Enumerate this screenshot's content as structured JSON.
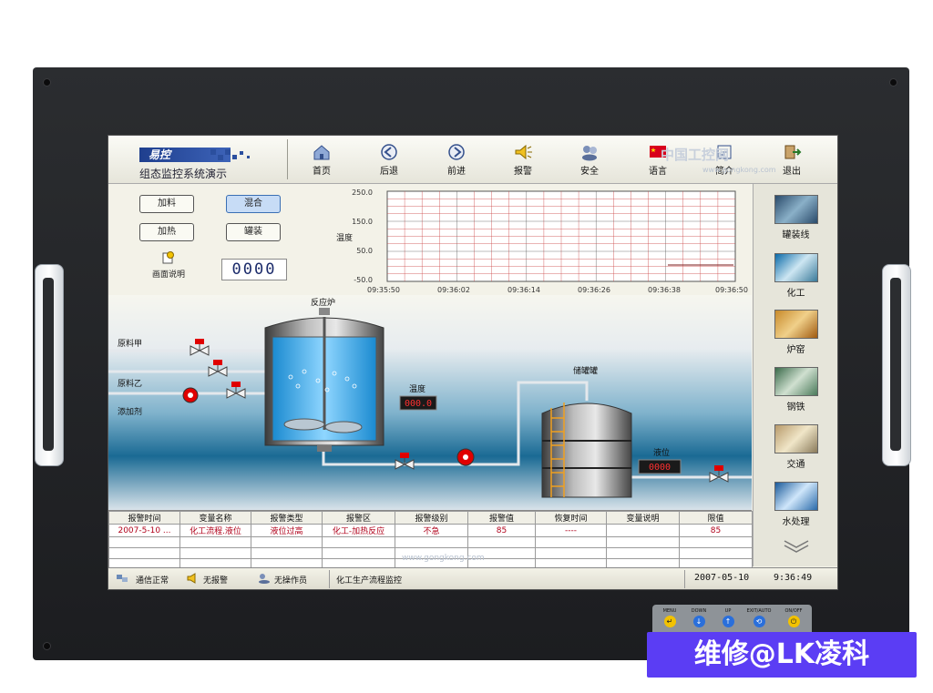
{
  "app": {
    "logo_text": "易控",
    "title": "组态监控系统演示"
  },
  "nav": [
    {
      "label": "首页",
      "icon": "home-icon"
    },
    {
      "label": "后退",
      "icon": "back-arrow-icon"
    },
    {
      "label": "前进",
      "icon": "forward-arrow-icon"
    },
    {
      "label": "报警",
      "icon": "alarm-horn-icon"
    },
    {
      "label": "安全",
      "icon": "users-icon"
    },
    {
      "label": "语言",
      "icon": "china-flag-icon"
    },
    {
      "label": "简介",
      "icon": "intro-icon"
    },
    {
      "label": "退出",
      "icon": "exit-icon"
    }
  ],
  "controls": {
    "btn_feed": "加料",
    "btn_mix": "混合",
    "btn_heat": "加热",
    "btn_fill": "罐装",
    "screen_desc": "画面说明",
    "counter": "0000"
  },
  "trend": {
    "ylabel": "温度",
    "yticks": [
      "250.0",
      "150.0",
      "50.0",
      "-50.0"
    ],
    "xticks": [
      "09:35:50",
      "09:36:02",
      "09:36:14",
      "09:36:26",
      "09:36:38",
      "09:36:50"
    ]
  },
  "process": {
    "reactor_label": "反应炉",
    "tank_label": "储罐罐",
    "line_a": "原料甲",
    "line_b": "原料乙",
    "line_c": "添加剂",
    "temp_label": "温度",
    "temp_value": "000.0",
    "level_label": "液位",
    "level_value": "0000"
  },
  "rightbar": [
    {
      "label": "罐装线",
      "icon": "filling-line-icon"
    },
    {
      "label": "化工",
      "icon": "chemical-icon"
    },
    {
      "label": "炉窑",
      "icon": "kiln-icon"
    },
    {
      "label": "钢铁",
      "icon": "steel-icon"
    },
    {
      "label": "交通",
      "icon": "traffic-icon"
    },
    {
      "label": "水处理",
      "icon": "water-treatment-icon"
    }
  ],
  "alarm": {
    "headers": [
      "报警时间",
      "变量名称",
      "报警类型",
      "报警区",
      "报警级别",
      "报警值",
      "恢复时间",
      "变量说明",
      "限值"
    ],
    "rows": [
      [
        "2007-5-10 ...",
        "化工流程.液位",
        "液位过高",
        "化工-加热反应",
        "不急",
        "85",
        "----",
        "",
        "85"
      ]
    ]
  },
  "status": {
    "comm": "通信正常",
    "alarm": "无报警",
    "operator": "无操作员",
    "desc": "化工生产流程监控",
    "date": "2007-05-10",
    "time": "9:36:49"
  },
  "watermarks": {
    "top": "中国工控网",
    "top_url": "www.gongkong.com",
    "bottom_url": "www.gongkong.com"
  },
  "keypad": [
    {
      "label": "MENU",
      "color": "#f2c200",
      "glyph": "↵"
    },
    {
      "label": "DOWN",
      "color": "#2a6fdb",
      "glyph": "↓"
    },
    {
      "label": "UP",
      "color": "#2a6fdb",
      "glyph": "↑"
    },
    {
      "label": "EXIT/AUTO",
      "color": "#2a6fdb",
      "glyph": "⟲"
    },
    {
      "label": "ON/OFF",
      "color": "#f2c200",
      "glyph": "⏻"
    }
  ],
  "badge": {
    "text": "维修@LK凌科"
  },
  "colors": {
    "bezel": "#1c1d20",
    "screen_bg": "#f3f2e8",
    "liquid": "#3aa9e8",
    "alarm_text": "#b0001a",
    "badge": "#5b3df4",
    "pipe": "#d8dde3"
  }
}
